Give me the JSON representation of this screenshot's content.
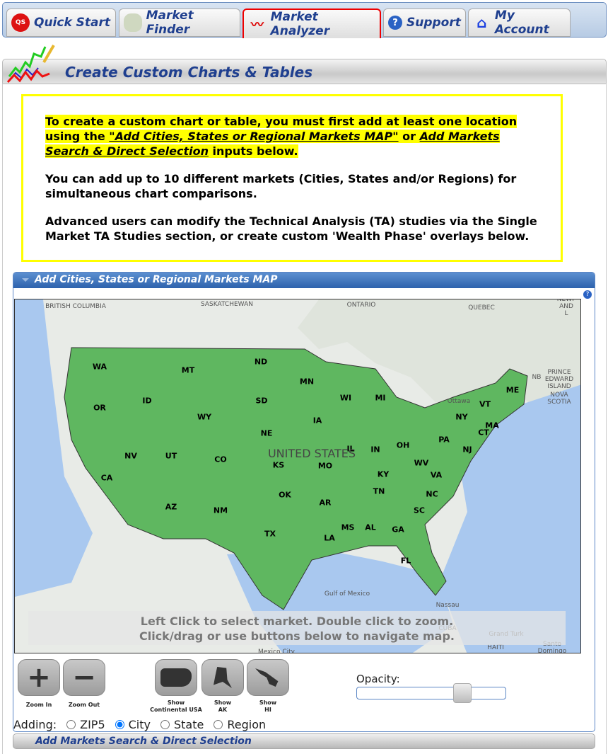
{
  "nav": {
    "tabs": [
      {
        "label": "Quick Start",
        "icon": "quick-start-icon",
        "active": false
      },
      {
        "label": "Market Finder",
        "icon": "map-icon",
        "active": false
      },
      {
        "label": "Market Analyzer",
        "icon": "chart-icon",
        "active": true
      },
      {
        "label": "Support",
        "icon": "help-icon",
        "active": false
      },
      {
        "label": "My Account",
        "icon": "home-icon",
        "active": false
      }
    ]
  },
  "header": {
    "title": "Create Custom Charts & Tables"
  },
  "notice": {
    "p1_a": "To create a custom chart or table, you must first add at least one location using the ",
    "link1": "\"Add Cities, States or Regional Markets MAP\"",
    "p1_b": " or ",
    "link2": "Add Markets Search & Direct Selection",
    "p1_c": " inputs below.",
    "p2": "You can add up to 10 different markets (Cities, States and/or Regions) for simultaneous chart comparisons.",
    "p3": "Advanced users can modify the Technical Analysis (TA) studies via the Single Market TA Studies section, or create custom 'Wealth Phase' overlays below."
  },
  "map_panel": {
    "title": "Add Cities, States or Regional Markets MAP",
    "help": "?",
    "states": [
      "WA",
      "OR",
      "CA",
      "ID",
      "NV",
      "MT",
      "WY",
      "UT",
      "AZ",
      "CO",
      "NM",
      "ND",
      "SD",
      "NE",
      "KS",
      "OK",
      "TX",
      "MN",
      "IA",
      "MO",
      "AR",
      "LA",
      "WI",
      "IL",
      "MI",
      "IN",
      "OH",
      "KY",
      "TN",
      "MS",
      "AL",
      "GA",
      "FL",
      "SC",
      "NC",
      "VA",
      "WV",
      "PA",
      "NY",
      "VT",
      "ME",
      "MA",
      "CT",
      "NJ"
    ],
    "geo_labels": [
      "BRITISH COLUMBIA",
      "SASKATCHEWAN",
      "ONTARIO",
      "QUEBEC",
      "NEWF AND L",
      "UNITED STATES",
      "Ottawa",
      "NB",
      "PRINCE EDWARD ISLAND",
      "NOVA SCOTIA",
      "Gulf of Mexico",
      "Nassau",
      "CUBA",
      "Grand Turk",
      "HAITI",
      "Santo Domingo",
      "Mexico City"
    ],
    "overlay_line1": "Left Click to select market. Double click to zoom.",
    "overlay_line2": "Click/drag or use buttons below to navigate map.",
    "buttons": {
      "zoom_in": "Zoom In",
      "zoom_out": "Zoom Out",
      "show_usa_1": "Show",
      "show_usa_2": "Continental USA",
      "show_ak_1": "Show",
      "show_ak_2": "AK",
      "show_hi_1": "Show",
      "show_hi_2": "HI"
    },
    "opacity_label": "Opacity:",
    "opacity_value": 0.7,
    "adding_label": "Adding:",
    "adding_options": [
      "ZIP5",
      "City",
      "State",
      "Region"
    ],
    "adding_selected": "City",
    "colors": {
      "state_fill": "#5fb760",
      "water": "#a9c8ef"
    }
  },
  "search_panel": {
    "title": "Add Markets Search & Direct Selection"
  }
}
